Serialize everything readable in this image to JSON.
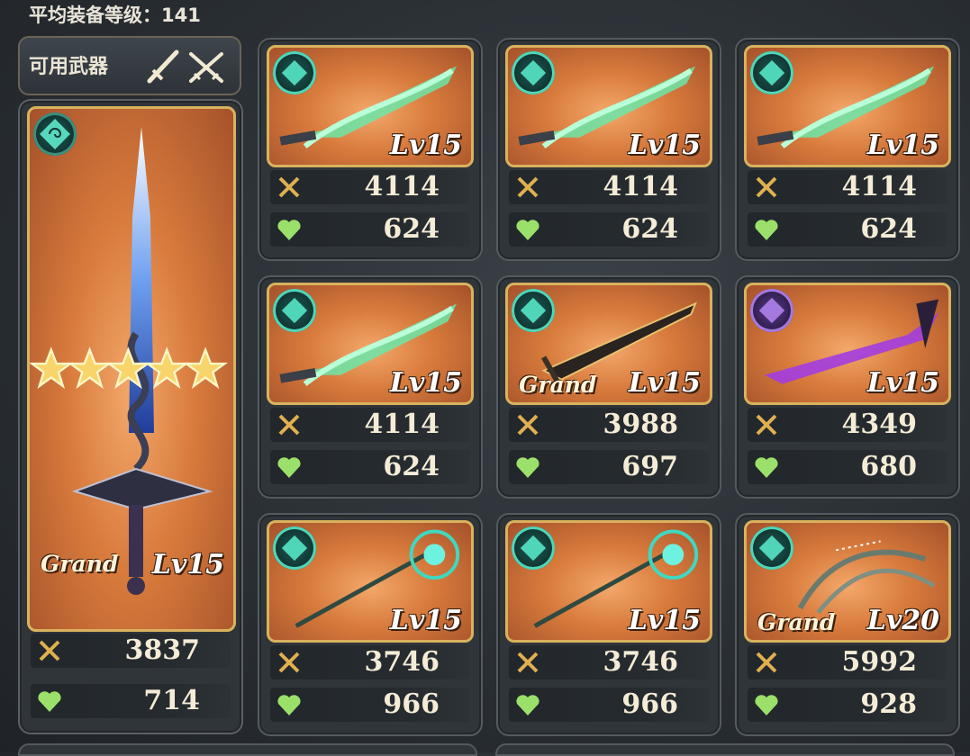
{
  "header": {
    "average_equipment_level": "平均装备等级：141"
  },
  "available_weapons": {
    "title": "可用武器",
    "icons": [
      "sword-icon",
      "dual-swords-icon"
    ]
  },
  "featured": {
    "element": "wind",
    "grade": "Grand",
    "level": "Lv15",
    "stars": 5,
    "attack": "3837",
    "hp": "714"
  },
  "weapons": [
    {
      "element": "wind",
      "art": "green-blade",
      "grade": "",
      "level": "Lv15",
      "attack": "4114",
      "hp": "624"
    },
    {
      "element": "wind",
      "art": "green-blade",
      "grade": "",
      "level": "Lv15",
      "attack": "4114",
      "hp": "624"
    },
    {
      "element": "wind",
      "art": "green-blade",
      "grade": "",
      "level": "Lv15",
      "attack": "4114",
      "hp": "624"
    },
    {
      "element": "wind",
      "art": "green-blade",
      "grade": "",
      "level": "Lv15",
      "attack": "4114",
      "hp": "624"
    },
    {
      "element": "wind",
      "art": "dark-blade",
      "grade": "Grand",
      "level": "Lv15",
      "attack": "3988",
      "hp": "697"
    },
    {
      "element": "dark",
      "art": "violet-scythe",
      "grade": "",
      "level": "Lv15",
      "attack": "4349",
      "hp": "680"
    },
    {
      "element": "wind",
      "art": "staff",
      "grade": "",
      "level": "Lv15",
      "attack": "3746",
      "hp": "966"
    },
    {
      "element": "wind",
      "art": "staff",
      "grade": "",
      "level": "Lv15",
      "attack": "3746",
      "hp": "966"
    },
    {
      "element": "wind",
      "art": "claws",
      "grade": "Grand",
      "level": "Lv20",
      "attack": "5992",
      "hp": "928"
    }
  ],
  "colors": {
    "wind": "#4fd6b8",
    "dark": "#a57ae0",
    "frame_gold": "#d9b25e",
    "attack_icon": "#e0b050",
    "hp_icon": "#9be06a"
  }
}
